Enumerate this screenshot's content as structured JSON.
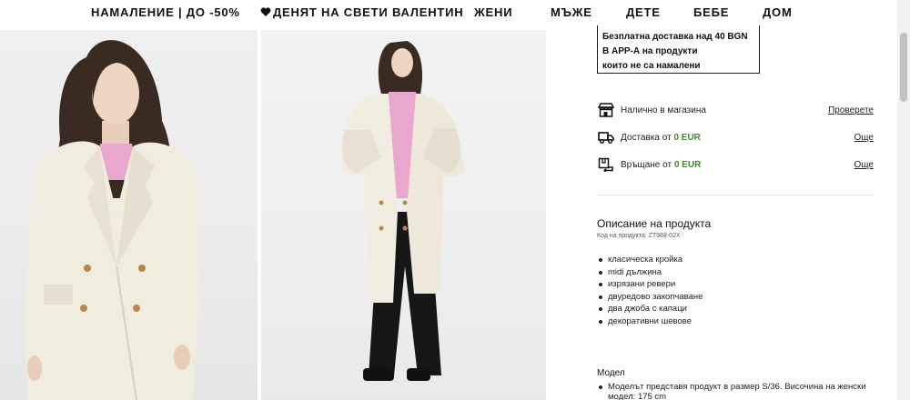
{
  "nav": {
    "items": [
      {
        "id": "sale",
        "label": "НАМАЛЕНИЕ | ДО -50%"
      },
      {
        "id": "valentine",
        "label": "ДЕНЯТ НА СВЕТИ ВАЛЕНТИН"
      },
      {
        "id": "women",
        "label": "ЖЕНИ"
      },
      {
        "id": "men",
        "label": "МЪЖЕ"
      },
      {
        "id": "kids",
        "label": "ДЕТЕ"
      },
      {
        "id": "baby",
        "label": "БЕБЕ"
      },
      {
        "id": "home",
        "label": "ДОМ"
      }
    ]
  },
  "gallery": {
    "icons": [
      "model-closeup-photo",
      "model-full-length-photo"
    ]
  },
  "promo": {
    "lines": [
      "Безплатна доставка над 40 BGN",
      "В APP-А на продукти",
      "които не са намалени"
    ]
  },
  "availability": {
    "text": "Налично в магазина",
    "link": "Проверете",
    "icon": "store-icon"
  },
  "delivery": {
    "text": "Доставка от ",
    "price": "0 EUR",
    "link": "Още",
    "icon": "truck-icon"
  },
  "returns": {
    "text": "Връщане от ",
    "price": "0 EUR",
    "link": "Още",
    "icon": "return-box-icon"
  },
  "description": {
    "title": "Описание на продукта",
    "code": "Код на продукта: ZT988-02X",
    "features": [
      "класическа кройка",
      "midi дължина",
      "изрязани ревери",
      "двуредово закопчаване",
      "два джоба с капаци",
      "декоративни шевове"
    ]
  },
  "model": {
    "title": "Модел",
    "text": "Моделът представя продукт в размер S/36. Височина на женски модел: 175 cm"
  },
  "colors": {
    "accent_green": "#3c8c2a",
    "coat": "#f1ece0",
    "sweater": "#e9a6cf"
  }
}
